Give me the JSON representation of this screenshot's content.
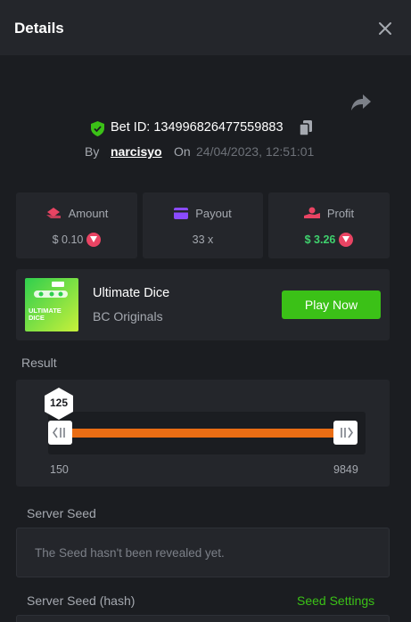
{
  "header": {
    "title": "Details"
  },
  "bet": {
    "id": "Bet ID: 134996826477559883",
    "by_label": "By",
    "user": "narcisyo",
    "on_label": "On",
    "date": "24/04/2023, 12:51:01"
  },
  "stats": {
    "amount": {
      "label": "Amount",
      "value": "$ 0.10",
      "color": "#e94463"
    },
    "payout": {
      "label": "Payout",
      "value": "33 x",
      "color": "#8a4bff"
    },
    "profit": {
      "label": "Profit",
      "value": "$ 3.26",
      "color": "#e94463",
      "value_color": "#3fd16d"
    }
  },
  "game": {
    "name": "Ultimate Dice",
    "provider": "BC Originals",
    "play_label": "Play Now",
    "thumb_text": "ULTIMATE\nDICE"
  },
  "result": {
    "label": "Result",
    "value": "125",
    "range_min": "150",
    "range_max": "9849"
  },
  "server_seed": {
    "label": "Server Seed",
    "text": "The Seed hasn't been revealed yet."
  },
  "server_seed_hash": {
    "label": "Server Seed (hash)",
    "settings_label": "Seed Settings"
  },
  "colors": {
    "accent_green": "#3bc117",
    "track_orange": "#ea6d14",
    "panel": "#24262b",
    "background": "#1b1d21"
  }
}
